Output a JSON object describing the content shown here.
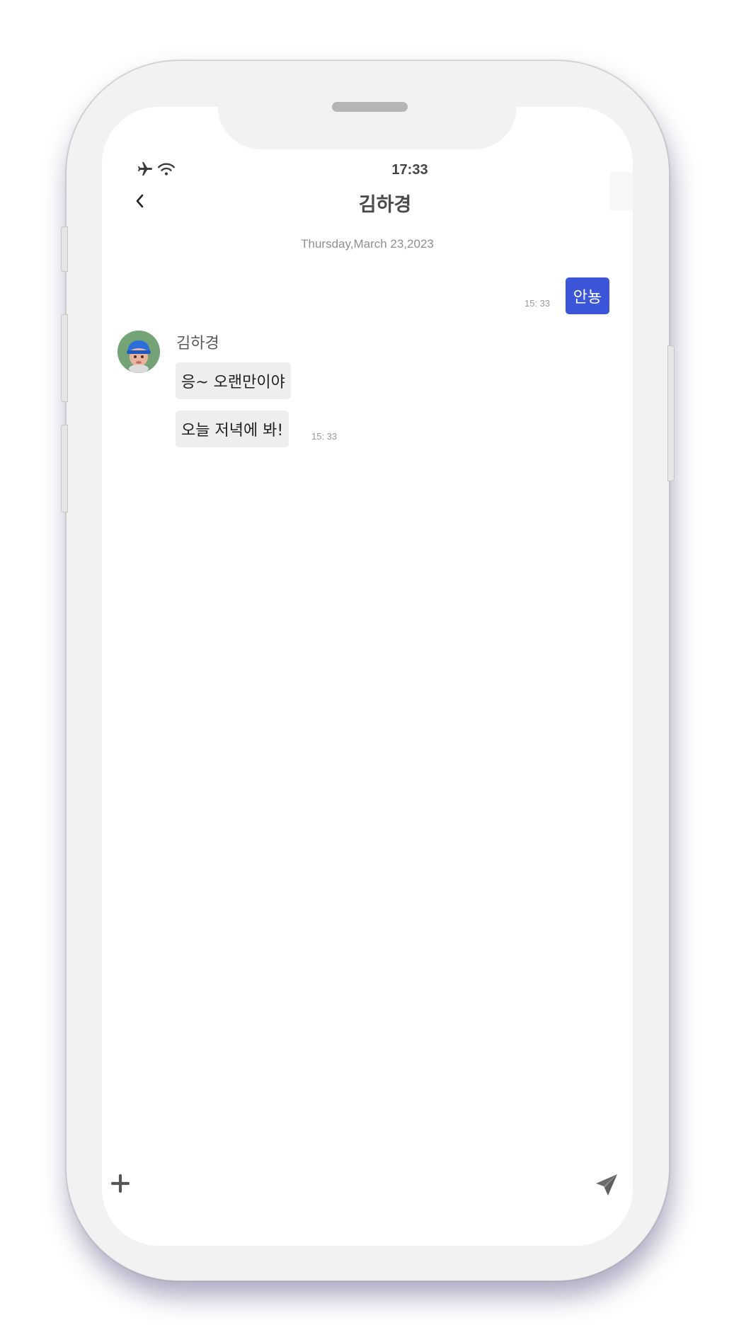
{
  "status_bar": {
    "time": "17:33",
    "icons": [
      "airplane-icon",
      "wifi-icon"
    ]
  },
  "header": {
    "title": "김하경",
    "back_icon": "chevron-left-icon"
  },
  "chat": {
    "date": "Thursday,March 23,2023",
    "messages": [
      {
        "sender": "me",
        "text": "안뇽",
        "time": "15: 33"
      },
      {
        "sender": "김하경",
        "text": "응~ 오랜만이야"
      },
      {
        "sender": "김하경",
        "text": "오늘 저녁에 봐!",
        "time": "15: 33"
      }
    ],
    "contact": {
      "name": "김하경",
      "avatar_icon": "avatar-icon"
    }
  },
  "input_bar": {
    "attach_icon": "plus-icon",
    "send_icon": "send-icon"
  },
  "colors": {
    "my_bubble": "#3b56d8",
    "other_bubble": "#eeeeee",
    "avatar_bg": "#74a378",
    "phone_body": "#f2f2f2"
  }
}
